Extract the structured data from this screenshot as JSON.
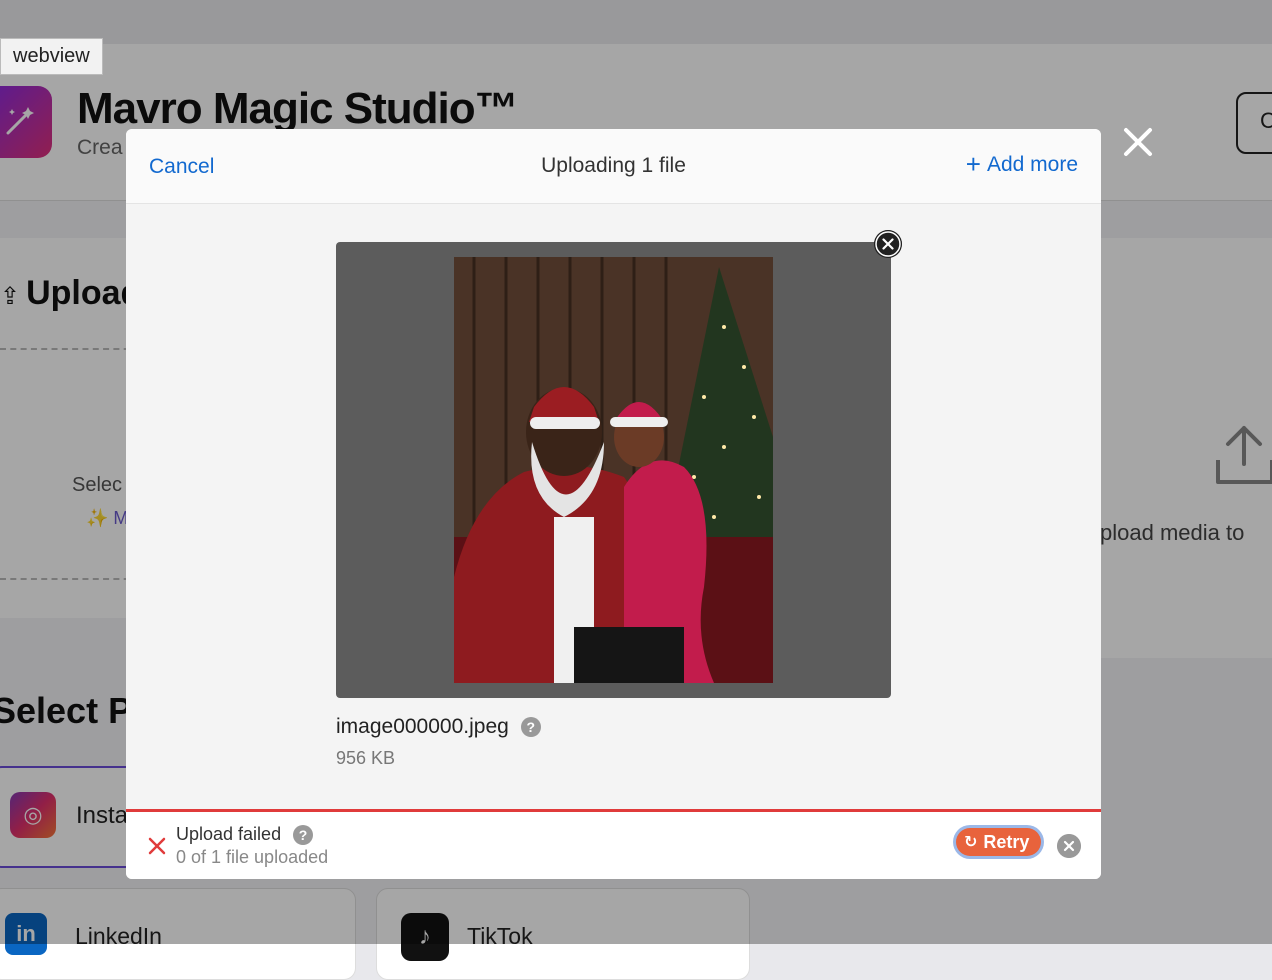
{
  "tooltip": "webview",
  "app": {
    "title": "Mavro Magic Studio™",
    "subtitle": "Crea",
    "header_button_letter": "C"
  },
  "background": {
    "upload_heading": "Upload",
    "select_text": "Selec",
    "magic_text": "✨ M",
    "right_text": "pload media to",
    "platform_heading": "Select Pl",
    "platforms": [
      {
        "name": "Insta",
        "icon": "instagram-icon"
      },
      {
        "name": "LinkedIn",
        "icon": "linkedin-icon"
      },
      {
        "name": "TikTok",
        "icon": "tiktok-icon"
      }
    ]
  },
  "modal": {
    "cancel_label": "Cancel",
    "title": "Uploading 1 file",
    "add_more_label": "Add more",
    "file": {
      "name": "image000000.jpeg",
      "size": "956 KB"
    },
    "status": {
      "title": "Upload failed",
      "subtitle": "0 of 1 file uploaded",
      "retry_label": "Retry"
    }
  },
  "colors": {
    "accent": "#1269cf",
    "error": "#e03b3b",
    "retry": "#e8633c"
  }
}
